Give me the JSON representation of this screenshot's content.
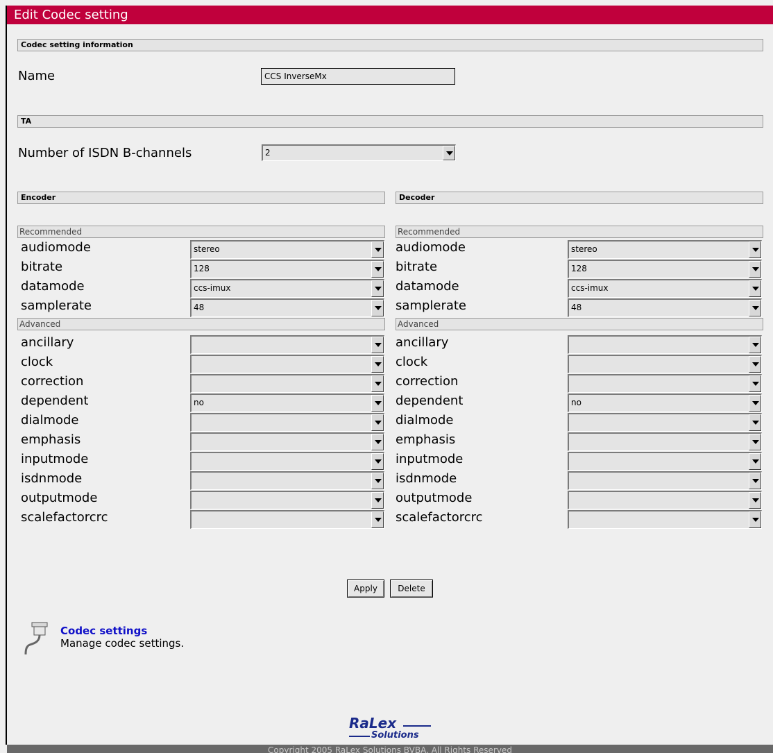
{
  "page_title": "Edit Codec setting",
  "sections": {
    "codec_info": "Codec setting information",
    "ta": "TA",
    "encoder": "Encoder",
    "decoder": "Decoder"
  },
  "name_field": {
    "label": "Name",
    "value": "CCS InverseMx"
  },
  "isdn_field": {
    "label": "Number of ISDN B-channels",
    "value": "2"
  },
  "groups": {
    "recommended": "Recommended",
    "advanced": "Advanced"
  },
  "encoder": {
    "recommended": [
      {
        "label": "audiomode",
        "value": "stereo"
      },
      {
        "label": "bitrate",
        "value": "128"
      },
      {
        "label": "datamode",
        "value": "ccs-imux"
      },
      {
        "label": "samplerate",
        "value": "48"
      }
    ],
    "advanced": [
      {
        "label": "ancillary",
        "value": ""
      },
      {
        "label": "clock",
        "value": ""
      },
      {
        "label": "correction",
        "value": ""
      },
      {
        "label": "dependent",
        "value": "no"
      },
      {
        "label": "dialmode",
        "value": ""
      },
      {
        "label": "emphasis",
        "value": ""
      },
      {
        "label": "inputmode",
        "value": ""
      },
      {
        "label": "isdnmode",
        "value": ""
      },
      {
        "label": "outputmode",
        "value": ""
      },
      {
        "label": "scalefactorcrc",
        "value": ""
      }
    ]
  },
  "decoder": {
    "recommended": [
      {
        "label": "audiomode",
        "value": "stereo"
      },
      {
        "label": "bitrate",
        "value": "128"
      },
      {
        "label": "datamode",
        "value": "ccs-imux"
      },
      {
        "label": "samplerate",
        "value": "48"
      }
    ],
    "advanced": [
      {
        "label": "ancillary",
        "value": ""
      },
      {
        "label": "clock",
        "value": ""
      },
      {
        "label": "correction",
        "value": ""
      },
      {
        "label": "dependent",
        "value": "no"
      },
      {
        "label": "dialmode",
        "value": ""
      },
      {
        "label": "emphasis",
        "value": ""
      },
      {
        "label": "inputmode",
        "value": ""
      },
      {
        "label": "isdnmode",
        "value": ""
      },
      {
        "label": "outputmode",
        "value": ""
      },
      {
        "label": "scalefactorcrc",
        "value": ""
      }
    ]
  },
  "buttons": {
    "apply": "Apply",
    "delete": "Delete"
  },
  "link": {
    "title": "Codec settings",
    "description": "Manage codec settings.",
    "icon": "connector-cable-icon"
  },
  "logo": {
    "top": "RaLex",
    "bottom": "Solutions"
  },
  "footer": "Copyright 2005 RaLex Solutions BVBA. All Rights Reserved",
  "colors": {
    "title_bar": "#c0003c",
    "link": "#1010c8",
    "footer": "#686868"
  }
}
